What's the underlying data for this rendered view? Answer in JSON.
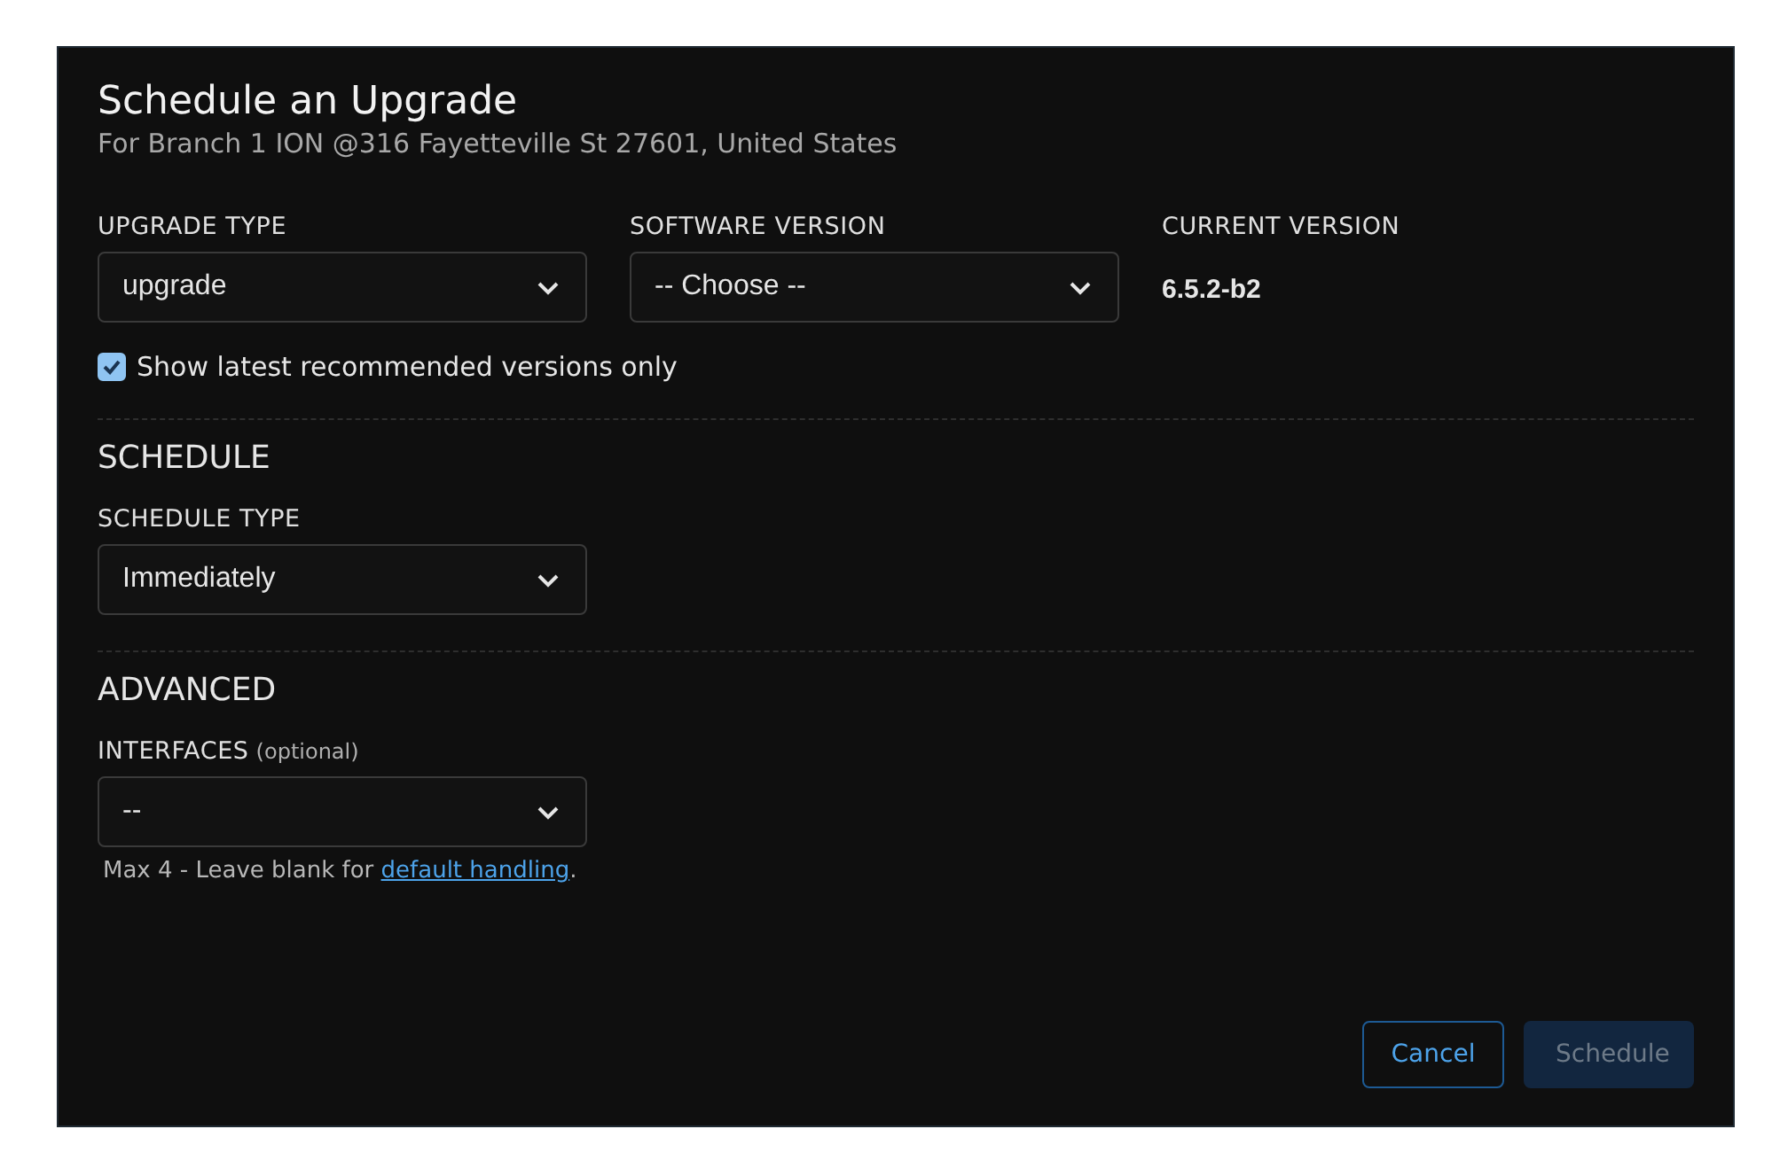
{
  "dialog": {
    "title": "Schedule an Upgrade",
    "subtitle": "For Branch 1 ION @316 Fayetteville St 27601, United States"
  },
  "upgrade": {
    "fields": [
      {
        "kind": "select",
        "label": "UPGRADE TYPE",
        "value": "upgrade"
      },
      {
        "kind": "select",
        "label": "SOFTWARE VERSION",
        "value": "-- Choose --"
      },
      {
        "kind": "readout",
        "label": "CURRENT VERSION",
        "value": "6.5.2-b2"
      }
    ],
    "checkbox": {
      "label": "Show latest recommended versions only",
      "checked": true
    }
  },
  "schedule": {
    "heading": "SCHEDULE",
    "label": "SCHEDULE TYPE",
    "value": "Immediately"
  },
  "advanced": {
    "heading": "ADVANCED",
    "label": "INTERFACES",
    "label_note": "(optional)",
    "value": "--",
    "hint": "Max 4 - Leave blank for",
    "hint_link": "default handling",
    "hint_end": "."
  },
  "buttons": [
    {
      "label": "Cancel",
      "kind": "secondary",
      "disabled": false
    },
    {
      "label": "Schedule",
      "kind": "primary",
      "disabled": true
    }
  ]
}
